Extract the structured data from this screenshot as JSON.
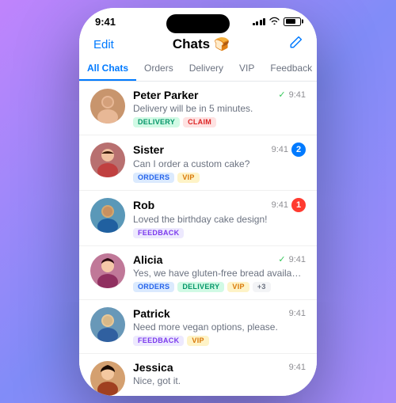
{
  "statusBar": {
    "time": "9:41"
  },
  "navBar": {
    "editLabel": "Edit",
    "title": "Chats",
    "titleEmoji": "🍞",
    "composeIcon": "✏️"
  },
  "tabs": [
    {
      "id": "all",
      "label": "All Chats",
      "active": true
    },
    {
      "id": "orders",
      "label": "Orders",
      "active": false
    },
    {
      "id": "delivery",
      "label": "Delivery",
      "active": false
    },
    {
      "id": "vip",
      "label": "VIP",
      "active": false
    },
    {
      "id": "feedback",
      "label": "Feedback",
      "active": false
    }
  ],
  "chats": [
    {
      "id": "peter",
      "name": "Peter Parker",
      "preview": "Delivery will be in 5 minutes.",
      "time": "9:41",
      "hasCheck": true,
      "badge": null,
      "tags": [
        {
          "type": "delivery",
          "label": "DELIVERY"
        },
        {
          "type": "claim",
          "label": "CLAIM"
        }
      ],
      "avatarClass": "av-peter",
      "avatarEmoji": "👨"
    },
    {
      "id": "sister",
      "name": "Sister",
      "preview": "Can I order a custom cake?",
      "time": "9:41",
      "hasCheck": false,
      "badge": "2",
      "badgeColor": "blue",
      "tags": [
        {
          "type": "orders",
          "label": "ORDERS"
        },
        {
          "type": "vip",
          "label": "VIP"
        }
      ],
      "avatarClass": "av-sister",
      "avatarEmoji": "👩"
    },
    {
      "id": "rob",
      "name": "Rob",
      "preview": "Loved the birthday cake design!",
      "time": "9:41",
      "hasCheck": false,
      "badge": "1",
      "badgeColor": "red",
      "tags": [
        {
          "type": "feedback",
          "label": "FEEDBACK"
        }
      ],
      "avatarClass": "av-rob",
      "avatarEmoji": "🧑"
    },
    {
      "id": "alicia",
      "name": "Alicia",
      "preview": "Yes, we have gluten-free bread available!",
      "time": "9:41",
      "hasCheck": true,
      "badge": null,
      "tags": [
        {
          "type": "orders",
          "label": "ORDERS"
        },
        {
          "type": "delivery",
          "label": "DELIVERY"
        },
        {
          "type": "vip",
          "label": "VIP"
        },
        {
          "type": "more",
          "label": "+3"
        }
      ],
      "avatarClass": "av-alicia",
      "avatarEmoji": "👩"
    },
    {
      "id": "patrick",
      "name": "Patrick",
      "preview": "Need more vegan options, please.",
      "time": "9:41",
      "hasCheck": false,
      "badge": null,
      "tags": [
        {
          "type": "feedback",
          "label": "FEEDBACK"
        },
        {
          "type": "vip",
          "label": "VIP"
        }
      ],
      "avatarClass": "av-patrick",
      "avatarEmoji": "👨"
    },
    {
      "id": "jessica",
      "name": "Jessica",
      "preview": "Nice, got it.",
      "time": "9:41",
      "hasCheck": false,
      "badge": null,
      "tags": [],
      "avatarClass": "av-jessica",
      "avatarEmoji": "👩"
    }
  ]
}
